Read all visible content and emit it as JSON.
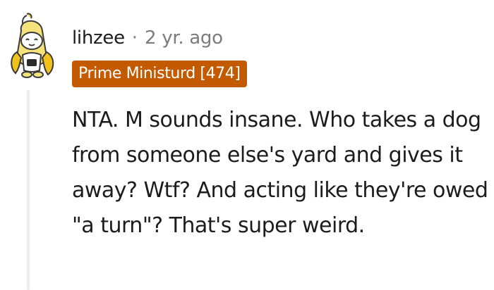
{
  "comment": {
    "username": "lihzee",
    "separator": "·",
    "timestamp": "2 yr. ago",
    "flair": "Prime Ministurd [474]",
    "flair_color": "#c35a00",
    "body": "NTA. M sounds insane. Who takes a dog from someone else's yard and gives it away? Wtf? And acting like they're owed \"a turn\"? That's super weird.",
    "avatar_icon": "banana-snoo-avatar-icon"
  }
}
